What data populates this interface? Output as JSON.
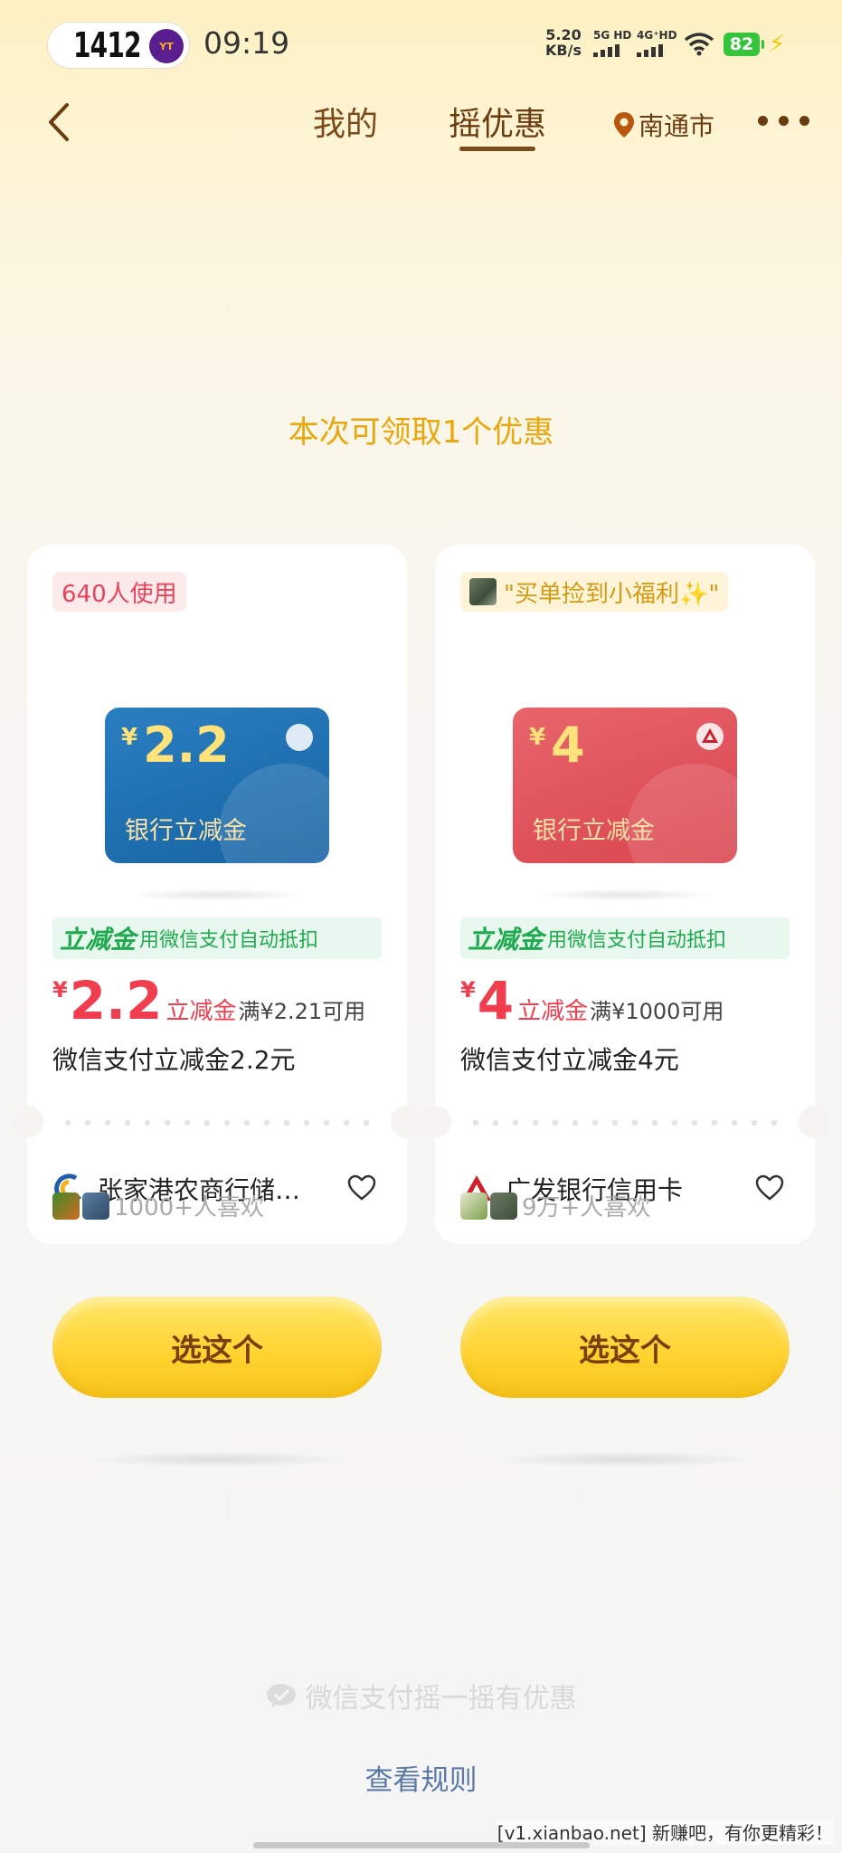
{
  "status_bar": {
    "badge_number": "1412",
    "badge_logo_text": "YT",
    "time": "09:19",
    "net_speed_value": "5.20",
    "net_speed_unit": "KB/s",
    "signal_1": "5G HD",
    "signal_2": "4G⁺HD",
    "battery": "82"
  },
  "nav": {
    "tabs": [
      {
        "label": "我的",
        "active": false
      },
      {
        "label": "摇优惠",
        "active": true
      }
    ],
    "location": "南通市"
  },
  "headline": "本次可领取1个优惠",
  "offers": [
    {
      "tag": "640人使用",
      "card_amount": "2.2",
      "card_currency": "¥",
      "card_label": "银行立减金",
      "card_color": "#1d6fb3",
      "feature_strong": "立减金",
      "feature_text": "用微信支付自动抵扣",
      "price_currency": "¥",
      "price_value": "2.2",
      "price_label": "立减金",
      "condition": "满¥2.21可用",
      "description": "微信支付立减金2.2元",
      "merchant": "张家港农商行储…",
      "likes": "1000+人喜欢",
      "button": "选这个"
    },
    {
      "tag": "\"买单捡到小福利✨\"",
      "card_amount": "4",
      "card_currency": "¥",
      "card_label": "银行立减金",
      "card_color": "#dd4f58",
      "feature_strong": "立减金",
      "feature_text": "用微信支付自动抵扣",
      "price_currency": "¥",
      "price_value": "4",
      "price_label": "立减金",
      "condition": "满¥1000可用",
      "description": "微信支付立减金4元",
      "merchant": "广发银行信用卡",
      "likes": "9万+人喜欢",
      "button": "选这个"
    }
  ],
  "footer": {
    "brand": "微信支付摇一摇有优惠",
    "rules_link": "查看规则",
    "watermark": "[v1.xianbao.net] 新赚吧，有你更精彩！"
  },
  "icons": [
    "back-arrow-icon",
    "location-pin-icon",
    "more-dots-icon",
    "heart-icon",
    "wechat-pay-icon",
    "wifi-icon",
    "charging-bolt-icon"
  ]
}
